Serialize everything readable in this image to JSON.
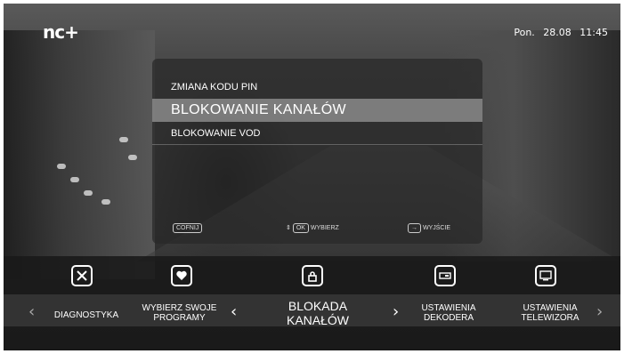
{
  "header": {
    "logo": "nc+",
    "day": "Pon.",
    "date": "28.08",
    "time": "11:45"
  },
  "menu": {
    "items": [
      {
        "label": "ZMIANA KODU PIN"
      },
      {
        "label": "BLOKOWANIE KANAŁÓW"
      },
      {
        "label": "BLOKOWANIE VOD"
      }
    ],
    "selected_index": 1
  },
  "footer": {
    "back_key": "COFNIJ",
    "ok_key": "OK",
    "select_label": "WYBIERZ",
    "exit_label": "WYJŚCIE"
  },
  "categories": [
    {
      "label": "DIAGNOSTYKA",
      "icon": "tools-icon"
    },
    {
      "label_line1": "WYBIERZ SWOJE",
      "label_line2": "PROGRAMY",
      "icon": "heart-icon"
    },
    {
      "label_line1": "BLOKADA",
      "label_line2": "KANAŁÓW",
      "icon": "lock-icon",
      "active": true
    },
    {
      "label_line1": "USTAWIENIA",
      "label_line2": "DEKODERA",
      "icon": "decoder-icon"
    },
    {
      "label_line1": "USTAWIENIA",
      "label_line2": "TELEWIZORA",
      "icon": "tv-icon"
    }
  ]
}
